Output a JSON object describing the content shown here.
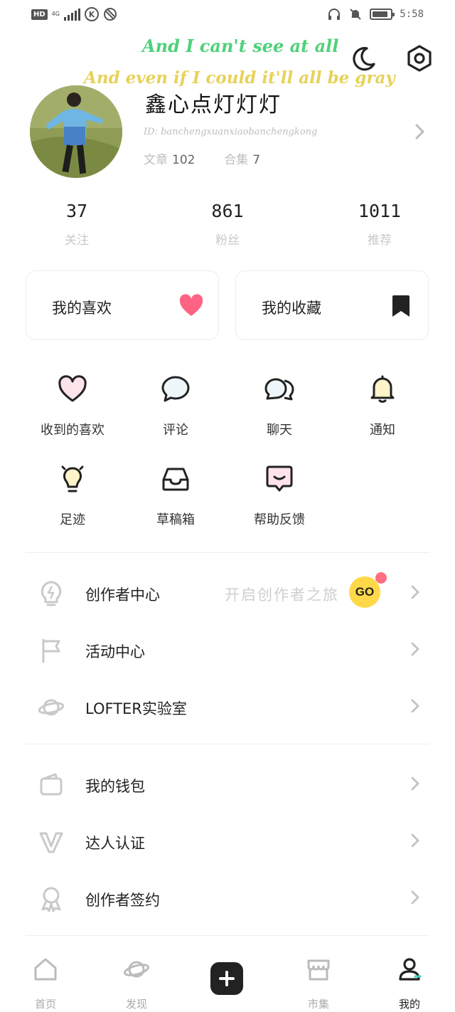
{
  "status_bar": {
    "hd": "HD",
    "network": "4G",
    "time": "5:58",
    "carrier_badge": "K"
  },
  "overlay_lyrics": {
    "line1": "And I can't see at all",
    "line2": "And even if I could it'll all be gray"
  },
  "header": {
    "night_mode_icon": "moon-icon",
    "settings_icon": "hexagon-gear-icon"
  },
  "profile": {
    "nickname": "鑫心点灯灯灯",
    "id_line": "ID: banchengxuanxiaobanchengkong",
    "articles_label": "文章",
    "articles_count": "102",
    "collections_label": "合集",
    "collections_count": "7"
  },
  "stats": [
    {
      "value": "37",
      "label": "关注"
    },
    {
      "value": "861",
      "label": "粉丝"
    },
    {
      "value": "1011",
      "label": "推荐"
    }
  ],
  "cards": {
    "likes_label": "我的喜欢",
    "favorites_label": "我的收藏",
    "heart_color": "#ff6384",
    "bookmark_color": "#222222"
  },
  "grid": [
    {
      "label": "收到的喜欢",
      "icon": "heart-outline-icon"
    },
    {
      "label": "评论",
      "icon": "comment-bubble-icon"
    },
    {
      "label": "聊天",
      "icon": "chat-bubbles-icon"
    },
    {
      "label": "通知",
      "icon": "bell-icon"
    },
    {
      "label": "足迹",
      "icon": "footprint-bulb-icon"
    },
    {
      "label": "草稿箱",
      "icon": "inbox-tray-icon"
    },
    {
      "label": "帮助反馈",
      "icon": "feedback-icon"
    }
  ],
  "list_group1": {
    "creator_center": "创作者中心",
    "creator_hint": "开启创作者之旅",
    "go_badge": "GO",
    "activity_center": "活动中心",
    "lab": "LOFTER实验室"
  },
  "list_group2": {
    "wallet": "我的钱包",
    "expert_cert": "达人认证",
    "creator_contract": "创作者签约"
  },
  "tabbar": {
    "home": "首页",
    "discover": "发现",
    "market": "市集",
    "mine": "我的"
  },
  "colors": {
    "accent_yellow": "#ffd84a",
    "notice_dot": "#ff6e82",
    "muted_text": "#c9c9c9"
  }
}
